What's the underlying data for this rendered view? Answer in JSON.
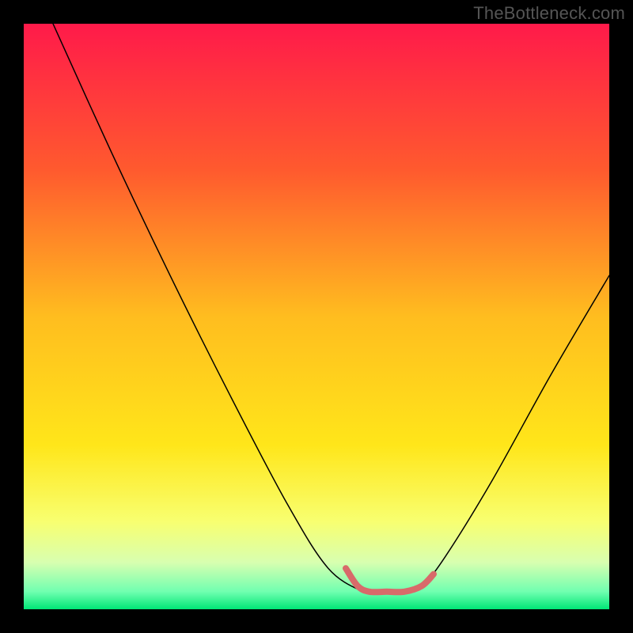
{
  "watermark": "TheBottleneck.com",
  "chart_data": {
    "type": "line",
    "title": "",
    "xlabel": "",
    "ylabel": "",
    "xlim": [
      0,
      100
    ],
    "ylim": [
      0,
      100
    ],
    "grid": false,
    "legend": false,
    "background_gradient": {
      "stops": [
        {
          "offset": 0.0,
          "color": "#ff1a4a"
        },
        {
          "offset": 0.25,
          "color": "#ff5a2e"
        },
        {
          "offset": 0.5,
          "color": "#ffbd1f"
        },
        {
          "offset": 0.72,
          "color": "#ffe61a"
        },
        {
          "offset": 0.85,
          "color": "#f8ff70"
        },
        {
          "offset": 0.92,
          "color": "#d8ffb0"
        },
        {
          "offset": 0.97,
          "color": "#70ffb0"
        },
        {
          "offset": 1.0,
          "color": "#00e676"
        }
      ]
    },
    "series": [
      {
        "name": "bottleneck-curve",
        "type": "line",
        "stroke": "#000000",
        "stroke_width": 1.5,
        "points": [
          {
            "x": 5,
            "y": 100
          },
          {
            "x": 15,
            "y": 78
          },
          {
            "x": 25,
            "y": 57
          },
          {
            "x": 35,
            "y": 37
          },
          {
            "x": 45,
            "y": 18
          },
          {
            "x": 52,
            "y": 7
          },
          {
            "x": 58,
            "y": 3
          },
          {
            "x": 60,
            "y": 3
          },
          {
            "x": 65,
            "y": 3
          },
          {
            "x": 68,
            "y": 4
          },
          {
            "x": 72,
            "y": 9
          },
          {
            "x": 80,
            "y": 22
          },
          {
            "x": 90,
            "y": 40
          },
          {
            "x": 100,
            "y": 57
          }
        ]
      },
      {
        "name": "optimal-range-marker",
        "type": "line",
        "stroke": "#d86a6a",
        "stroke_width": 8,
        "points": [
          {
            "x": 55,
            "y": 7
          },
          {
            "x": 57,
            "y": 4
          },
          {
            "x": 59,
            "y": 3
          },
          {
            "x": 62,
            "y": 3
          },
          {
            "x": 65,
            "y": 3
          },
          {
            "x": 68,
            "y": 4
          },
          {
            "x": 70,
            "y": 6
          }
        ]
      }
    ]
  }
}
